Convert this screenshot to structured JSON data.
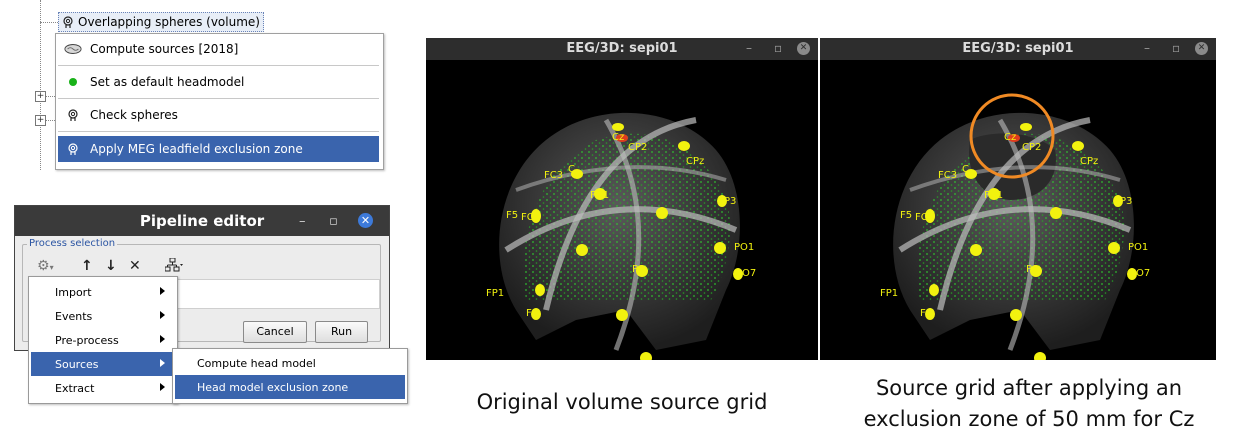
{
  "tree": {
    "node_label": "Overlapping spheres (volume)",
    "context_menu": [
      {
        "label": "Compute sources [2018]",
        "icon": "brain-icon"
      },
      {
        "label": "Set as default headmodel",
        "icon": "green-dot-icon"
      },
      {
        "label": "Check spheres",
        "icon": "spheres-icon"
      },
      {
        "label": "Apply MEG leadfield exclusion zone",
        "icon": "spheres-icon",
        "selected": true
      }
    ]
  },
  "pipeline_editor": {
    "title": "Pipeline editor",
    "section_label": "Process selection",
    "cancel_label": "Cancel",
    "run_label": "Run",
    "menu": [
      "Import",
      "Events",
      "Pre-process",
      "Sources",
      "Extract"
    ],
    "selected_menu": "Sources",
    "submenu": [
      "Compute head model",
      "Head model exclusion zone"
    ],
    "selected_submenu": "Head model exclusion zone"
  },
  "eeg_left": {
    "title": "EEG/3D: sepi01"
  },
  "eeg_right": {
    "title": "EEG/3D: sepi01"
  },
  "electrode_labels": [
    "CP2",
    "Cz",
    "CPz",
    "FC3",
    "C",
    "FC1",
    "F5",
    "FC",
    "P3",
    "PO1",
    "PO7",
    "FP1",
    "F",
    "P8",
    "F5"
  ],
  "colors": {
    "selection": "#3a64ad",
    "electrode": "#f2f20f",
    "grid": "#2ecc2e",
    "highlight_circle": "#f08a24"
  },
  "captions": {
    "left": "Original volume source grid",
    "right_line1": "Source grid after applying an",
    "right_line2": "exclusion zone of 50 mm for Cz"
  }
}
